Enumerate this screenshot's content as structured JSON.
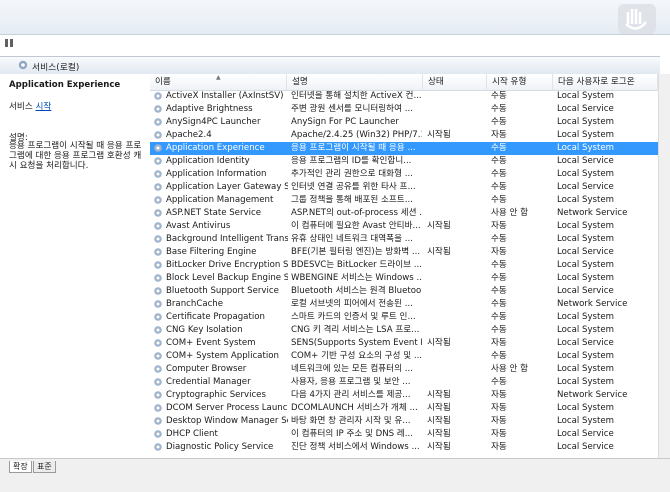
{
  "panel": {
    "title": "서비스(로컬)"
  },
  "left_pane": {
    "service_title": "Application Experience",
    "service_label": "서비스",
    "start_link": "시작",
    "description_label": "설명:",
    "description": "응용 프로그램이 시작될 때 응용 프로그램에 대한 응용 프로그램 호환성 캐시 요청을 처리합니다."
  },
  "columns": [
    "이름",
    "설명",
    "상태",
    "시작 유형",
    "다음 사용자로 로그온"
  ],
  "selected_row": 5,
  "rows": [
    {
      "name": "ActiveX Installer (AxInstSV)",
      "desc": "인터넷을 통해 설치한 ActiveX 컨...",
      "status": "",
      "startup": "수동",
      "logon": "Local System"
    },
    {
      "name": "Adaptive Brightness",
      "desc": "주변 광원 센서를 모니터링하여 ...",
      "status": "",
      "startup": "수동",
      "logon": "Local Service"
    },
    {
      "name": "AnySign4PC Launcher",
      "desc": "AnySign For PC Launcher",
      "status": "",
      "startup": "수동",
      "logon": "Local System"
    },
    {
      "name": "Apache2.4",
      "desc": "Apache/2.4.25 (Win32) PHP/7.1.0",
      "status": "시작됨",
      "startup": "자동",
      "logon": "Local System"
    },
    {
      "name": "Application Experience",
      "desc": "응용 프로그램이 시작될 때 응용 ...",
      "status": "",
      "startup": "수동",
      "logon": "Local System"
    },
    {
      "name": "Application Identity",
      "desc": "응용 프로그램의 ID를 확인합니...",
      "status": "",
      "startup": "수동",
      "logon": "Local Service"
    },
    {
      "name": "Application Information",
      "desc": "추가적인 관리 권한으로 대화형 ...",
      "status": "",
      "startup": "수동",
      "logon": "Local System"
    },
    {
      "name": "Application Layer Gateway Ser...",
      "desc": "인터넷 연결 공유를 위한 타사 프...",
      "status": "",
      "startup": "수동",
      "logon": "Local Service"
    },
    {
      "name": "Application Management",
      "desc": "그룹 정책을 통해 배포된 소프트...",
      "status": "",
      "startup": "수동",
      "logon": "Local System"
    },
    {
      "name": "ASP.NET State Service",
      "desc": "ASP.NET의 out-of-process 세션 ...",
      "status": "",
      "startup": "사용 안 함",
      "logon": "Network Service"
    },
    {
      "name": "Avast Antivirus",
      "desc": "이 컴퓨터에 필요한 Avast 안티바...",
      "status": "시작됨",
      "startup": "자동",
      "logon": "Local System"
    },
    {
      "name": "Background Intelligent Transfer...",
      "desc": "유휴 상태인 네트워크 대역폭을 ...",
      "status": "",
      "startup": "수동",
      "logon": "Local System"
    },
    {
      "name": "Base Filtering Engine",
      "desc": "BFE(기본 필터링 엔진)는 방화벽 ...",
      "status": "시작됨",
      "startup": "자동",
      "logon": "Local Service"
    },
    {
      "name": "BitLocker Drive Encryption Ser...",
      "desc": "BDESVC는 BitLocker 드라이브 ...",
      "status": "",
      "startup": "수동",
      "logon": "Local System"
    },
    {
      "name": "Block Level Backup Engine Ser...",
      "desc": "WBENGINE 서비스는 Windows ...",
      "status": "",
      "startup": "수동",
      "logon": "Local System"
    },
    {
      "name": "Bluetooth Support Service",
      "desc": "Bluetooth 서비스는 원격 Bluetoo...",
      "status": "",
      "startup": "수동",
      "logon": "Local Service"
    },
    {
      "name": "BranchCache",
      "desc": "로컬 서브넷의 피어에서 전송된 ...",
      "status": "",
      "startup": "수동",
      "logon": "Network Service"
    },
    {
      "name": "Certificate Propagation",
      "desc": "스마트 카드의 인증서 및 루트 인...",
      "status": "",
      "startup": "수동",
      "logon": "Local System"
    },
    {
      "name": "CNG Key Isolation",
      "desc": "CNG 키 격리 서비스는 LSA 프로...",
      "status": "",
      "startup": "수동",
      "logon": "Local System"
    },
    {
      "name": "COM+ Event System",
      "desc": "SENS(Supports System Event No...",
      "status": "시작됨",
      "startup": "자동",
      "logon": "Local Service"
    },
    {
      "name": "COM+ System Application",
      "desc": "COM+ 기반 구성 요소의 구성 및 ...",
      "status": "",
      "startup": "수동",
      "logon": "Local System"
    },
    {
      "name": "Computer Browser",
      "desc": "네트워크에 있는 모든 컴퓨터의 ...",
      "status": "",
      "startup": "사용 안 함",
      "logon": "Local System"
    },
    {
      "name": "Credential Manager",
      "desc": "사용자, 응용 프로그램 및 보안 ...",
      "status": "",
      "startup": "수동",
      "logon": "Local System"
    },
    {
      "name": "Cryptographic Services",
      "desc": "다음 4가지 관리 서비스를 제공...",
      "status": "시작됨",
      "startup": "자동",
      "logon": "Network Service"
    },
    {
      "name": "DCOM Server Process Launcher",
      "desc": "DCOMLAUNCH 서비스가 개체 ...",
      "status": "시작됨",
      "startup": "자동",
      "logon": "Local System"
    },
    {
      "name": "Desktop Window Manager Ses...",
      "desc": "바탕 화면 창 관리자 시작 및 유...",
      "status": "시작됨",
      "startup": "자동",
      "logon": "Local System"
    },
    {
      "name": "DHCP Client",
      "desc": "이 컴퓨터의 IP 주소 및 DNS 레...",
      "status": "시작됨",
      "startup": "자동",
      "logon": "Local Service"
    },
    {
      "name": "Diagnostic Policy Service",
      "desc": "진단 정책 서비스에서 Windows ...",
      "status": "시작됨",
      "startup": "자동",
      "logon": "Local Service"
    }
  ],
  "tabs": [
    "확장",
    "표준"
  ],
  "icons": {
    "service": "gear-icon",
    "pause": "pause-icon"
  },
  "colors": {
    "selection": "#3399ff",
    "link": "#0046b4"
  }
}
